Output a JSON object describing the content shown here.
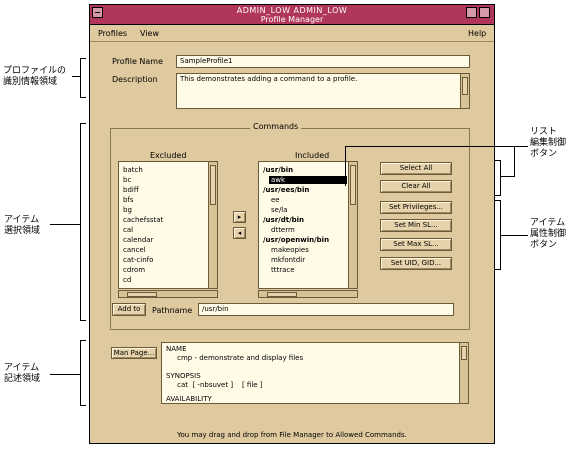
{
  "window": {
    "title_top": "ADMIN_LOW ADMIN_LOW",
    "title": "Profile Manager"
  },
  "menubar": {
    "profiles": "Profiles",
    "view": "View",
    "help": "Help"
  },
  "form": {
    "profile_name_label": "Profile Name",
    "profile_name_value": "SampleProfile1",
    "description_label": "Description",
    "description_value": "This demonstrates adding a command to a profile."
  },
  "commands": {
    "group_label": "Commands",
    "excluded_label": "Excluded",
    "included_label": "Included",
    "excluded_items": [
      "batch",
      "bc",
      "bdiff",
      "bfs",
      "bg",
      "cachefsstat",
      "cal",
      "calendar",
      "cancel",
      "cat-cinfo",
      "cdrom",
      "cd"
    ],
    "included_items": [
      {
        "text": "/usr/bin",
        "bold": true,
        "selected": false
      },
      {
        "text": "awk",
        "bold": false,
        "selected": true
      },
      {
        "text": "/usr/ees/bin",
        "bold": true,
        "selected": false
      },
      {
        "text": "ee",
        "bold": false,
        "selected": false
      },
      {
        "text": "se/la",
        "bold": false,
        "selected": false
      },
      {
        "text": "/usr/dt/bin",
        "bold": true,
        "selected": false
      },
      {
        "text": "dtterm",
        "bold": false,
        "selected": false
      },
      {
        "text": "/usr/openwin/bin",
        "bold": true,
        "selected": false
      },
      {
        "text": "makeopies",
        "bold": false,
        "selected": false
      },
      {
        "text": "mkfontdir",
        "bold": false,
        "selected": false
      },
      {
        "text": "tttrace",
        "bold": false,
        "selected": false
      }
    ],
    "add_arrow": "▸",
    "remove_arrow": "◂",
    "select_all": "Select All",
    "clear_all": "Clear All",
    "set_privileges": "Set Privileges...",
    "set_min_sl": "Set Min SL...",
    "set_max_sl": "Set Max SL...",
    "set_uid_gid": "Set UID, GID...",
    "add_button": "Add to",
    "pathname_label": "Pathname",
    "pathname_value": "/usr/bin"
  },
  "manpage": {
    "button": "Man Page...",
    "lines": [
      "NAME",
      "     cmp - demonstrate and display files",
      "",
      "SYNOPSIS",
      "     cat  [ -nbsuvet ]    [ file ]",
      "",
      "AVAILABILITY"
    ]
  },
  "status": "You may drag and drop from File Manager to Allowed Commands.",
  "annotations": {
    "profile_id_area": "プロファイルの\n識別情報領域",
    "item_select_area": "アイテム\n選択領域",
    "item_desc_area": "アイテム\n記述領域",
    "list_edit_buttons": "リスト\n編集制御\nボタン",
    "item_attr_buttons": "アイテム\n属性制御\nボタン"
  }
}
